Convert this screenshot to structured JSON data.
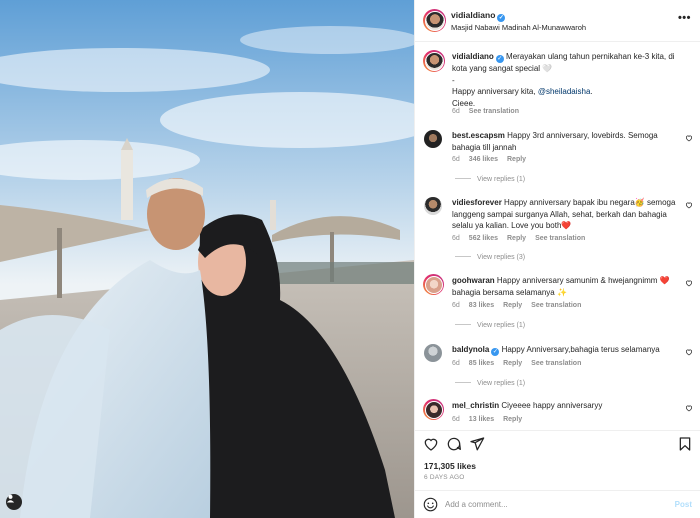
{
  "post": {
    "username": "vidialdiano",
    "location": "Masjid Nabawi Madinah Al-Munawwaroh",
    "more_label": "•••",
    "photo_alt": "Couple selfie at Masjid Nabawi"
  },
  "caption": {
    "username": "vidialdiano",
    "line1": "Merayakan ulang tahun pernikahan ke-3 kita, di kota yang sangat special 🤍",
    "line2": "-",
    "line3_prefix": "Happy anniversary kita, ",
    "mention": "@sheiladaisha",
    "line3_suffix": ".",
    "line4": "Cieee.",
    "time": "6d",
    "see_translation": "See translation"
  },
  "comments": [
    {
      "username": "best.escapsm",
      "text": "Happy 3rd anniversary, lovebirds. Semoga bahagia till jannah",
      "time": "6d",
      "likes": "346 likes",
      "reply": "Reply",
      "translation": "",
      "view_replies": "View replies (1)"
    },
    {
      "username": "vidiesforever",
      "text": "Happy anniversary bapak ibu negara🥳 semoga langgeng sampai surganya Allah, sehat, berkah dan bahagia selalu ya kalian. Love you both❤️",
      "time": "6d",
      "likes": "562 likes",
      "reply": "Reply",
      "translation": "See translation",
      "view_replies": "View replies (3)"
    },
    {
      "username": "goohwaran",
      "text": "Happy anniversary samunim & hwejangnimm ❤️ bahagia bersama selamanya ✨",
      "time": "6d",
      "likes": "83 likes",
      "reply": "Reply",
      "translation": "See translation",
      "view_replies": "View replies (1)"
    },
    {
      "username": "baldynola",
      "text": "Happy Anniversary,bahagia terus selamanya",
      "time": "6d",
      "likes": "85 likes",
      "reply": "Reply",
      "translation": "See translation",
      "view_replies": "View replies (1)"
    },
    {
      "username": "mel_christin",
      "text": "Ciyeeee happy anniversaryy",
      "time": "6d",
      "likes": "13 likes",
      "reply": "Reply",
      "translation": "",
      "view_replies": ""
    }
  ],
  "stats": {
    "likes": "171,305 likes",
    "time_ago": "6 DAYS AGO"
  },
  "composer": {
    "placeholder": "Add a comment...",
    "post_label": "Post"
  },
  "colors": {
    "verified": "#3897f0",
    "link": "#00376b",
    "heart_liked": "#ed4956",
    "post_disabled": "#b2dffc"
  },
  "icons": [
    "verified-badge-icon",
    "heart-icon",
    "comment-icon",
    "share-icon",
    "bookmark-icon",
    "emoji-icon",
    "user-tag-icon"
  ]
}
